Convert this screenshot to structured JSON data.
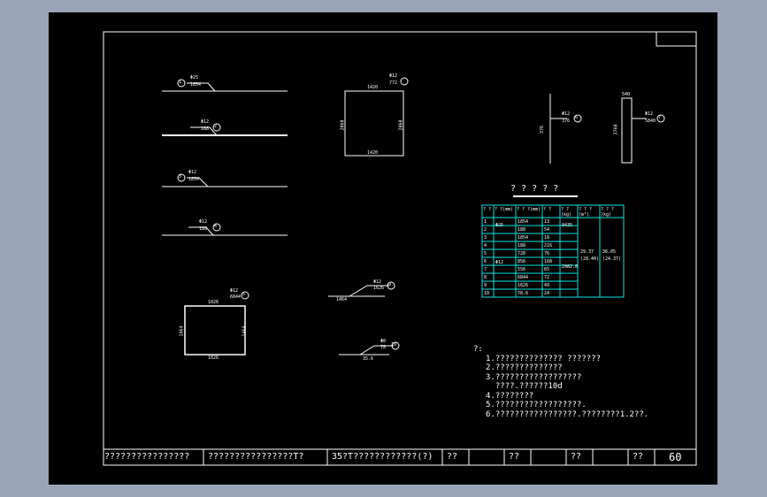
{
  "table_title": "? ? ? ? ?",
  "table": {
    "headers": [
      "? ?",
      "? ?(mm)",
      "? ? ?(mm)",
      "? ?",
      "? ?(kg)",
      "? ? ?(m³)",
      "? ? ?(kg)"
    ],
    "rows": [
      [
        "1",
        "Φ25",
        "1854",
        "13",
        "9435",
        "",
        ""
      ],
      [
        "2",
        "",
        "188",
        "54",
        "",
        "",
        ""
      ],
      [
        "3",
        "",
        "1854",
        "18",
        "",
        "",
        ""
      ],
      [
        "4",
        "",
        "188",
        "216",
        "",
        "",
        ""
      ],
      [
        "5",
        "Φ12",
        "728",
        "76",
        "",
        "",
        ""
      ],
      [
        "6",
        "",
        "856",
        "168",
        "",
        "",
        ""
      ],
      [
        "7",
        "",
        "556",
        "65",
        "2982.0",
        "",
        ""
      ],
      [
        "8",
        "",
        "6844",
        "72",
        "",
        "",
        ""
      ],
      [
        "9",
        "",
        "1626",
        "49",
        "",
        "",
        ""
      ],
      [
        "10",
        "",
        "78.6",
        "24",
        "",
        "",
        ""
      ]
    ],
    "merged": {
      "col6": "29.37\n(28.40)",
      "col7": "36.05\n(24.37)"
    }
  },
  "bars": [
    {
      "num": "1",
      "dia": "Φ25",
      "len": "1854"
    },
    {
      "num": "2",
      "dia": "Φ12",
      "len": "188"
    },
    {
      "num": "3",
      "dia": "Φ12",
      "len": "1854"
    },
    {
      "num": "4",
      "dia": "Φ12",
      "len": "188"
    },
    {
      "num": "5",
      "dia": "Φ12",
      "len": "772"
    },
    {
      "num": "6",
      "dia": "Φ12",
      "len": "376"
    },
    {
      "num": "7",
      "dia": "Φ12",
      "len": "5840"
    },
    {
      "num": "8",
      "dia": "Φ12",
      "len": "6844"
    },
    {
      "num": "9",
      "dia": "Φ12",
      "len": "1626"
    },
    {
      "num": "10",
      "dia": "Φ8",
      "len": "78"
    }
  ],
  "dims": {
    "sq_top": "1420",
    "sq_bottom": "1420",
    "sq_left": "2060",
    "sq_right": "2060",
    "rect_top": "1026",
    "rect_bottom": "1026",
    "rect_left": "1464",
    "rect_right": "1464",
    "bar6_len": "376",
    "bar7_top": "540",
    "bar7_len": "3760",
    "bar9_len": "1464",
    "bar10_len": "35.6"
  },
  "notes": {
    "label": "?:",
    "lines": [
      "1.?????????????? ???????",
      "2.??????????????",
      "3.??????????????????",
      "  ????.??????10d",
      "4.????????",
      "5.??????????????????.",
      "6.?????????????????.????????1.2??."
    ]
  },
  "titleblock": {
    "c1": "????????????????",
    "c2": "????????????????T?",
    "c3": "35?T????????????(?)",
    "c4": "??",
    "c5": "??",
    "c6": "??",
    "c7": "??",
    "page": "60"
  }
}
